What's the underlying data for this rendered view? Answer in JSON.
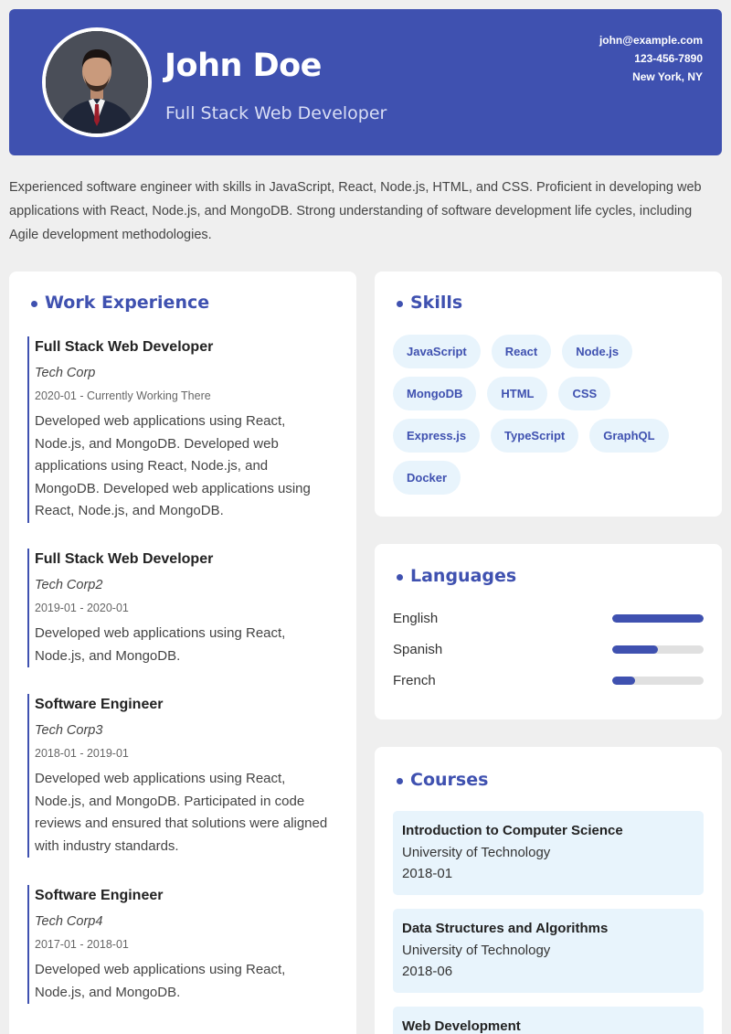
{
  "header": {
    "name": "John Doe",
    "title": "Full Stack Web Developer",
    "email": "john@example.com",
    "phone": "123-456-7890",
    "location": "New York, NY",
    "accent": "#3f51b0"
  },
  "summary": "Experienced software engineer with skills in JavaScript, React, Node.js, HTML, and CSS. Proficient in developing web applications with React, Node.js, and MongoDB. Strong understanding of software development life cycles, including Agile development methodologies.",
  "work": {
    "heading": "Work Experience",
    "jobs": [
      {
        "title": "Full Stack Web Developer",
        "company": "Tech Corp",
        "dates": "2020-01 - Currently Working There",
        "description": "Developed web applications using React, Node.js, and MongoDB. Developed web applications using React, Node.js, and MongoDB. Developed web applications using React, Node.js, and MongoDB."
      },
      {
        "title": "Full Stack Web Developer",
        "company": "Tech Corp2",
        "dates": "2019-01 - 2020-01",
        "description": "Developed web applications using React, Node.js, and MongoDB."
      },
      {
        "title": "Software Engineer",
        "company": "Tech Corp3",
        "dates": "2018-01 - 2019-01",
        "description": "Developed web applications using React, Node.js, and MongoDB. Participated in code reviews and ensured that solutions were aligned with industry standards."
      },
      {
        "title": "Software Engineer",
        "company": "Tech Corp4",
        "dates": "2017-01 - 2018-01",
        "description": "Developed web applications using React, Node.js, and MongoDB."
      }
    ]
  },
  "skills": {
    "heading": "Skills",
    "items": [
      "JavaScript",
      "React",
      "Node.js",
      "MongoDB",
      "HTML",
      "CSS",
      "Express.js",
      "TypeScript",
      "GraphQL",
      "Docker"
    ]
  },
  "languages": {
    "heading": "Languages",
    "items": [
      {
        "name": "English",
        "level": 1.0
      },
      {
        "name": "Spanish",
        "level": 0.5
      },
      {
        "name": "French",
        "level": 0.25
      }
    ]
  },
  "courses": {
    "heading": "Courses",
    "items": [
      {
        "title": "Introduction to Computer Science",
        "school": "University of Technology",
        "date": "2018-01"
      },
      {
        "title": "Data Structures and Algorithms",
        "school": "University of Technology",
        "date": "2018-06"
      },
      {
        "title": "Web Development",
        "school": "",
        "date": ""
      }
    ]
  }
}
